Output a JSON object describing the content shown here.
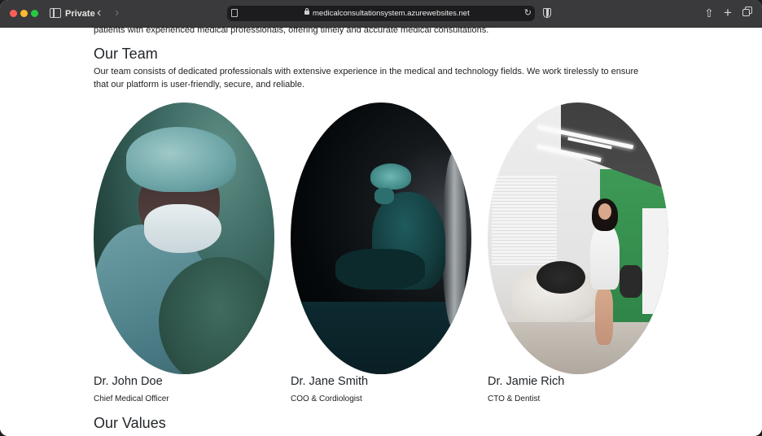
{
  "browser": {
    "private_label": "Private",
    "url": "medicalconsultationsystem.azurewebsites.net"
  },
  "intro": {
    "tail_text": "patients with experienced medical professionals, offering timely and accurate medical consultations."
  },
  "team": {
    "title": "Our Team",
    "description": "Our team consists of dedicated professionals with extensive experience in the medical and technology fields. We work tirelessly to ensure that our platform is user-friendly, secure, and reliable.",
    "members": [
      {
        "name": "Dr. John Doe",
        "role": "Chief Medical Officer"
      },
      {
        "name": "Dr. Jane Smith",
        "role": "COO & Cordiologist"
      },
      {
        "name": "Dr. Jamie Rich",
        "role": "CTO & Dentist"
      }
    ]
  },
  "values": {
    "title": "Our Values"
  }
}
